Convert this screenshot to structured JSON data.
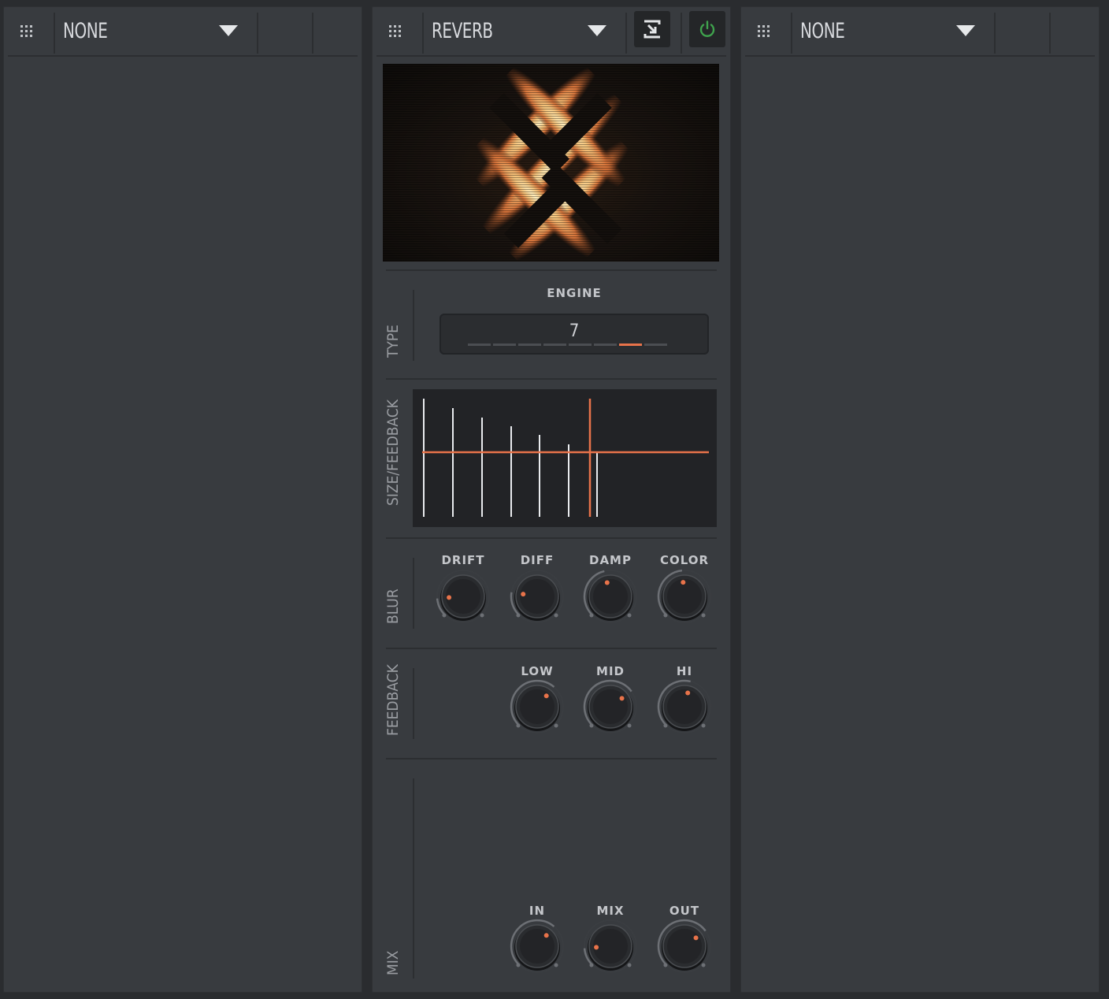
{
  "slots": {
    "left": {
      "name": "NONE"
    },
    "middle": {
      "name": "REVERB"
    },
    "right": {
      "name": "NONE"
    }
  },
  "reverb": {
    "type_section": {
      "label": "TYPE",
      "engine_label": "ENGINE",
      "engine_value": "7",
      "engine_segments": 8,
      "engine_selected": 7
    },
    "size_feedback_label": "SIZE/FEEDBACK",
    "blur": {
      "label": "BLUR",
      "knobs": [
        {
          "label": "DRIFT",
          "value": 0.15
        },
        {
          "label": "DIFF",
          "value": 0.2
        },
        {
          "label": "DAMP",
          "value": 0.45
        },
        {
          "label": "COLOR",
          "value": 0.48
        }
      ]
    },
    "feedback": {
      "label": "FEEDBACK",
      "knobs": [
        {
          "label": "LOW",
          "value": 0.65
        },
        {
          "label": "MID",
          "value": 0.7
        },
        {
          "label": "HI",
          "value": 0.55
        }
      ]
    },
    "mix": {
      "label": "MIX",
      "knobs": [
        {
          "label": "IN",
          "value": 0.65
        },
        {
          "label": "MIX",
          "value": 0.15
        },
        {
          "label": "OUT",
          "value": 0.7
        }
      ]
    }
  },
  "colors": {
    "accent": "#e8734a",
    "power": "#3fa34d"
  },
  "icons": {
    "drag_handle": "grid-dots-icon",
    "dropdown": "caret-down-icon",
    "swap": "swap-icon",
    "power": "power-icon"
  }
}
